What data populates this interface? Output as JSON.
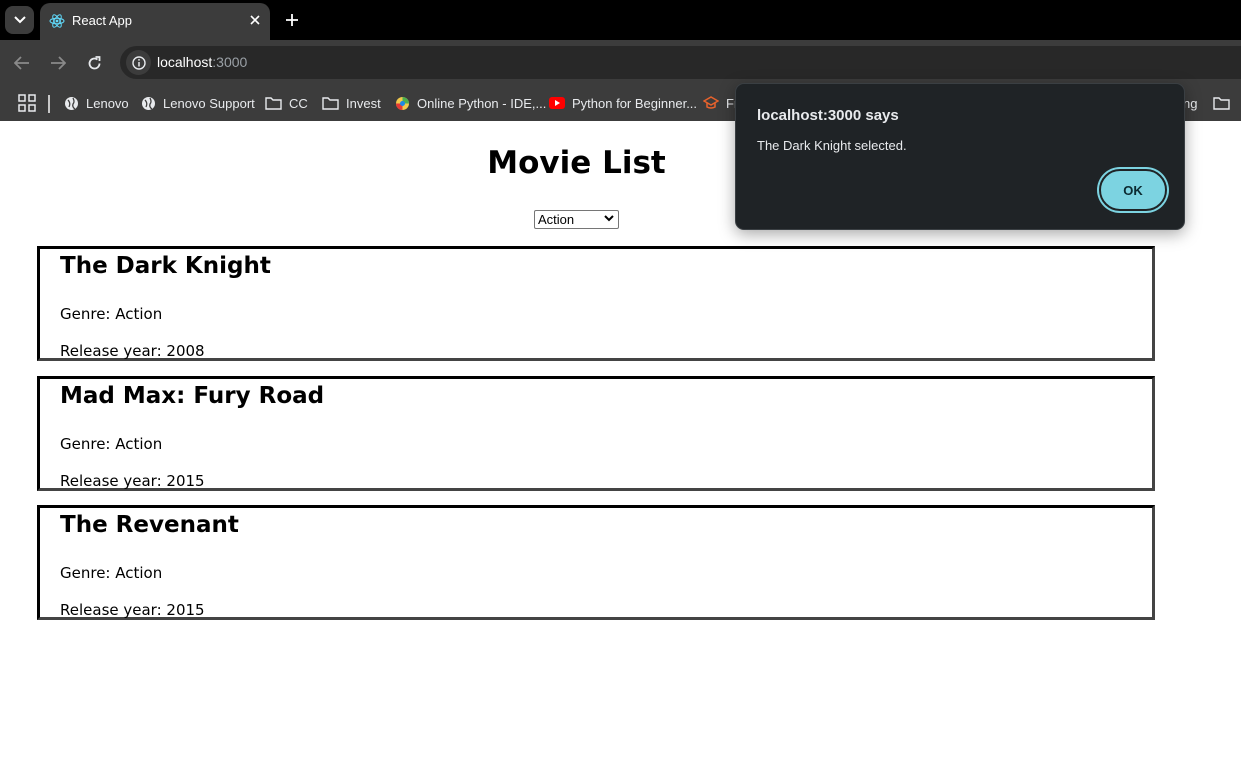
{
  "browser": {
    "tab": {
      "title": "React App",
      "favicon": "react-logo-icon"
    },
    "address": {
      "host": "localhost",
      "port": ":3000"
    },
    "bookmarks": [
      {
        "label": "Lenovo",
        "icon": "globe-icon"
      },
      {
        "label": "Lenovo Support",
        "icon": "globe-icon"
      },
      {
        "label": "CC",
        "icon": "folder-icon"
      },
      {
        "label": "Invest",
        "icon": "folder-icon"
      },
      {
        "label": "Online Python - IDE,...",
        "icon": "python-site-icon"
      },
      {
        "label": "Python for Beginner...",
        "icon": "youtube-icon"
      },
      {
        "label": "Fr",
        "icon": "course-icon"
      },
      {
        "label": "ng",
        "icon": "folder-icon"
      }
    ]
  },
  "page": {
    "title": "Movie List",
    "genre_select": {
      "value": "Action"
    },
    "movies": [
      {
        "title": "The Dark Knight",
        "genre": "Genre: Action",
        "year": "Release year: 2008"
      },
      {
        "title": "Mad Max: Fury Road",
        "genre": "Genre: Action",
        "year": "Release year: 2015"
      },
      {
        "title": "The Revenant",
        "genre": "Genre: Action",
        "year": "Release year: 2015"
      }
    ]
  },
  "dialog": {
    "title": "localhost:3000 says",
    "message": "The Dark Knight selected.",
    "ok_label": "OK"
  },
  "colors": {
    "dialog_bg": "#1f2326",
    "ok_button": "#7cd3e1",
    "chrome_bg": "#3c3c3c"
  }
}
